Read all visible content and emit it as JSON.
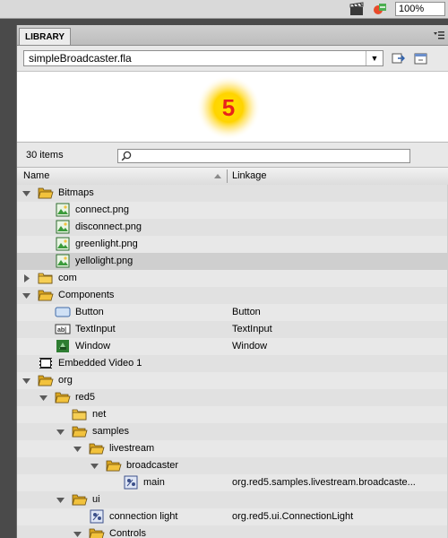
{
  "toolbar": {
    "zoom_value": "100%"
  },
  "panel": {
    "tab_label": "LIBRARY",
    "document_name": "simpleBroadcaster.fla",
    "preview_badge": "5",
    "items_count": "30 items",
    "search_value": "",
    "columns": {
      "name": "Name",
      "linkage": "Linkage"
    }
  },
  "rows": [
    {
      "name": "Bitmaps",
      "linkage": "",
      "icon": "folder-open-icon",
      "depth": 0,
      "twisty": "open"
    },
    {
      "name": "connect.png",
      "linkage": "",
      "icon": "bitmap-icon",
      "depth": 1,
      "twisty": ""
    },
    {
      "name": "disconnect.png",
      "linkage": "",
      "icon": "bitmap-icon",
      "depth": 1,
      "twisty": ""
    },
    {
      "name": "greenlight.png",
      "linkage": "",
      "icon": "bitmap-icon",
      "depth": 1,
      "twisty": ""
    },
    {
      "name": "yellolight.png",
      "linkage": "",
      "icon": "bitmap-icon",
      "depth": 1,
      "twisty": "",
      "selected": true
    },
    {
      "name": "com",
      "linkage": "",
      "icon": "folder-closed-icon",
      "depth": 0,
      "twisty": "closed"
    },
    {
      "name": "Components",
      "linkage": "",
      "icon": "folder-open-icon",
      "depth": 0,
      "twisty": "open"
    },
    {
      "name": "Button",
      "linkage": "Button",
      "icon": "button-symbol-icon",
      "depth": 1,
      "twisty": ""
    },
    {
      "name": "TextInput",
      "linkage": "TextInput",
      "icon": "textinput-symbol-icon",
      "depth": 1,
      "twisty": ""
    },
    {
      "name": "Window",
      "linkage": "Window",
      "icon": "component-icon",
      "depth": 1,
      "twisty": ""
    },
    {
      "name": "Embedded Video 1",
      "linkage": "",
      "icon": "video-icon",
      "depth": 0,
      "twisty": ""
    },
    {
      "name": "org",
      "linkage": "",
      "icon": "folder-open-icon",
      "depth": 0,
      "twisty": "open"
    },
    {
      "name": "red5",
      "linkage": "",
      "icon": "folder-open-icon",
      "depth": 1,
      "twisty": "open"
    },
    {
      "name": "net",
      "linkage": "",
      "icon": "folder-closed-icon",
      "depth": 2,
      "twisty": ""
    },
    {
      "name": "samples",
      "linkage": "",
      "icon": "folder-open-icon",
      "depth": 2,
      "twisty": "open"
    },
    {
      "name": "livestream",
      "linkage": "",
      "icon": "folder-open-icon",
      "depth": 3,
      "twisty": "open"
    },
    {
      "name": "broadcaster",
      "linkage": "",
      "icon": "folder-open-icon",
      "depth": 4,
      "twisty": "open"
    },
    {
      "name": "main",
      "linkage": "org.red5.samples.livestream.broadcaste...",
      "icon": "movieclip-icon",
      "depth": 5,
      "twisty": ""
    },
    {
      "name": "ui",
      "linkage": "",
      "icon": "folder-open-icon",
      "depth": 2,
      "twisty": "open"
    },
    {
      "name": "connection light",
      "linkage": "org.red5.ui.ConnectionLight",
      "icon": "movieclip-icon",
      "depth": 3,
      "twisty": ""
    },
    {
      "name": "Controls",
      "linkage": "",
      "icon": "folder-open-icon",
      "depth": 3,
      "twisty": "open"
    }
  ],
  "colors": {
    "row_alt": "#e1e1e1",
    "row_selected": "#cfcfcf",
    "folder": "#f2c23c",
    "badge": "#e8231b"
  }
}
